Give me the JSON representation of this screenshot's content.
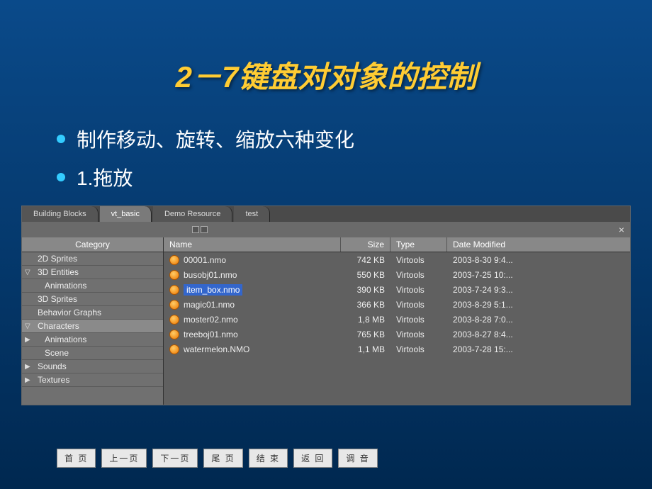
{
  "title": "2－7键盘对对象的控制",
  "bullets": [
    "制作移动、旋转、缩放六种变化",
    "1.拖放"
  ],
  "tabs": [
    {
      "label": "Building Blocks",
      "active": false
    },
    {
      "label": "vt_basic",
      "active": true
    },
    {
      "label": "Demo Resource",
      "active": false
    },
    {
      "label": "test",
      "active": false
    }
  ],
  "sidebar_header": "Category",
  "categories": [
    {
      "label": "2D Sprites",
      "arrow": "",
      "sub": false,
      "selected": false
    },
    {
      "label": "3D Entities",
      "arrow": "▽",
      "sub": false,
      "selected": false
    },
    {
      "label": "Animations",
      "arrow": "",
      "sub": true,
      "selected": false
    },
    {
      "label": "3D Sprites",
      "arrow": "",
      "sub": false,
      "selected": false
    },
    {
      "label": "Behavior Graphs",
      "arrow": "",
      "sub": false,
      "selected": false
    },
    {
      "label": "Characters",
      "arrow": "▽",
      "sub": false,
      "selected": true
    },
    {
      "label": "Animations",
      "arrow": "▶",
      "sub": true,
      "selected": false
    },
    {
      "label": "Scene",
      "arrow": "",
      "sub": true,
      "selected": false
    },
    {
      "label": "Sounds",
      "arrow": "▶",
      "sub": false,
      "selected": false
    },
    {
      "label": "Textures",
      "arrow": "▶",
      "sub": false,
      "selected": false
    }
  ],
  "file_headers": {
    "name": "Name",
    "size": "Size",
    "type": "Type",
    "date": "Date Modified"
  },
  "files": [
    {
      "name": "00001.nmo",
      "size": "742 KB",
      "type": "Virtools",
      "date": "2003-8-30 9:4...",
      "selected": false
    },
    {
      "name": "busobj01.nmo",
      "size": "550 KB",
      "type": "Virtools",
      "date": "2003-7-25 10:...",
      "selected": false
    },
    {
      "name": "item_box.nmo",
      "size": "390 KB",
      "type": "Virtools",
      "date": "2003-7-24 9:3...",
      "selected": true
    },
    {
      "name": "magic01.nmo",
      "size": "366 KB",
      "type": "Virtools",
      "date": "2003-8-29 5:1...",
      "selected": false
    },
    {
      "name": "moster02.nmo",
      "size": "1,8 MB",
      "type": "Virtools",
      "date": "2003-8-28 7:0...",
      "selected": false
    },
    {
      "name": "treeboj01.nmo",
      "size": "765 KB",
      "type": "Virtools",
      "date": "2003-8-27 8:4...",
      "selected": false
    },
    {
      "name": "watermelon.NMO",
      "size": "1,1 MB",
      "type": "Virtools",
      "date": "2003-7-28 15:...",
      "selected": false
    }
  ],
  "nav": [
    "首 页",
    "上一页",
    "下一页",
    "尾 页",
    "结 束",
    "返 回",
    "调 音"
  ]
}
